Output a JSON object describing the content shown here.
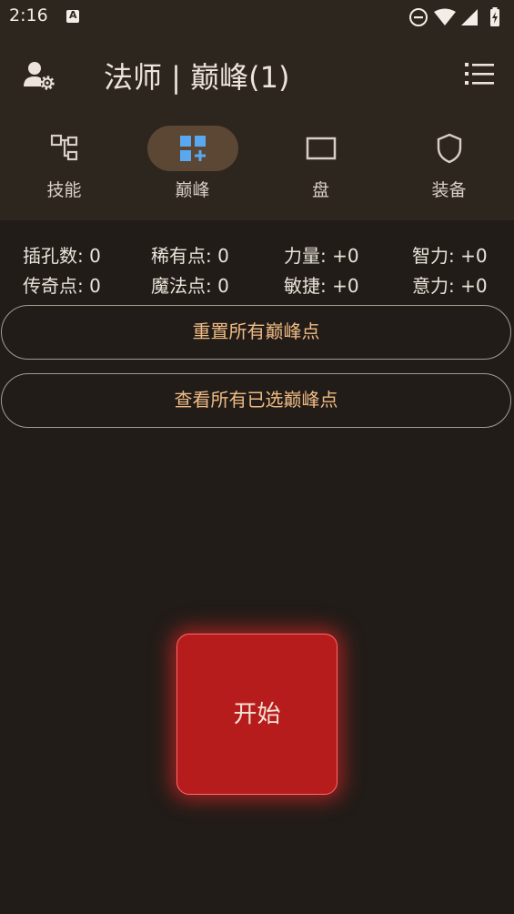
{
  "status_bar": {
    "time": "2:16",
    "a_badge": "A"
  },
  "appbar": {
    "title": "法师 | 巅峰(1)"
  },
  "tabs": [
    {
      "label": "技能",
      "icon": "skill-tree-icon",
      "active": false
    },
    {
      "label": "巅峰",
      "icon": "dashboard-add-icon",
      "active": true
    },
    {
      "label": "盘",
      "icon": "rectangle-icon",
      "active": false
    },
    {
      "label": "装备",
      "icon": "shield-icon",
      "active": false
    }
  ],
  "stats": {
    "socket": "插孔数: 0",
    "rare": "稀有点: 0",
    "strength": "力量: +0",
    "intelligence": "智力: +0",
    "legendary": "传奇点: 0",
    "magic": "魔法点: 0",
    "dexterity": "敏捷: +0",
    "willpower": "意力: +0"
  },
  "buttons": {
    "reset": "重置所有巅峰点",
    "view": "查看所有已选巅峰点",
    "start": "开始"
  },
  "colors": {
    "background": "#211c18",
    "header": "#2d261f",
    "accent_text": "#f0bb84",
    "start": "#b71c1c",
    "active_icon": "#5aa8f0"
  }
}
